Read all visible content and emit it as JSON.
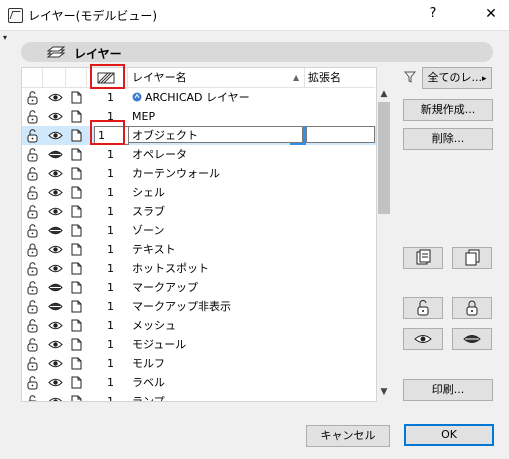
{
  "window": {
    "title": "レイヤー(モデルビュー)",
    "help_label": "?",
    "close_label": "✕"
  },
  "header": {
    "title": "レイヤー",
    "collapse_glyph": "▾"
  },
  "columns": {
    "name": "レイヤー名",
    "extension": "拡張名",
    "sort_glyph": "▲"
  },
  "rows": [
    {
      "lock": "unlocked",
      "visible": "shown",
      "wire": "solid",
      "num": "1",
      "name": "ARCHICAD レイヤー",
      "special": true
    },
    {
      "lock": "unlocked",
      "visible": "shown",
      "wire": "solid",
      "num": "1",
      "name": "MEP"
    },
    {
      "lock": "unlocked",
      "visible": "shown",
      "wire": "solid",
      "num": "1",
      "name": "オブジェクト",
      "selected": true
    },
    {
      "lock": "unlocked",
      "visible": "hidden",
      "wire": "solid",
      "num": "1",
      "name": "オペレータ"
    },
    {
      "lock": "unlocked",
      "visible": "shown",
      "wire": "solid",
      "num": "1",
      "name": "カーテンウォール"
    },
    {
      "lock": "unlocked",
      "visible": "shown",
      "wire": "solid",
      "num": "1",
      "name": "シェル"
    },
    {
      "lock": "unlocked",
      "visible": "shown",
      "wire": "solid",
      "num": "1",
      "name": "スラブ"
    },
    {
      "lock": "unlocked",
      "visible": "hidden",
      "wire": "solid",
      "num": "1",
      "name": "ゾーン"
    },
    {
      "lock": "locked",
      "visible": "shown",
      "wire": "solid",
      "num": "1",
      "name": "テキスト"
    },
    {
      "lock": "unlocked",
      "visible": "shown",
      "wire": "solid",
      "num": "1",
      "name": "ホットスポット"
    },
    {
      "lock": "unlocked",
      "visible": "hidden",
      "wire": "solid",
      "num": "1",
      "name": "マークアップ"
    },
    {
      "lock": "unlocked",
      "visible": "hidden",
      "wire": "solid",
      "num": "1",
      "name": "マークアップ非表示"
    },
    {
      "lock": "unlocked",
      "visible": "shown",
      "wire": "solid",
      "num": "1",
      "name": "メッシュ"
    },
    {
      "lock": "unlocked",
      "visible": "shown",
      "wire": "solid",
      "num": "1",
      "name": "モジュール"
    },
    {
      "lock": "unlocked",
      "visible": "shown",
      "wire": "solid",
      "num": "1",
      "name": "モルフ"
    },
    {
      "lock": "unlocked",
      "visible": "shown",
      "wire": "solid",
      "num": "1",
      "name": "ラベル"
    },
    {
      "lock": "unlocked",
      "visible": "shown",
      "wire": "solid",
      "num": "1",
      "name": "ランプ"
    }
  ],
  "scrollbar": {
    "up": "▲",
    "down": "▼"
  },
  "filter": {
    "label": "全てのレ...",
    "arrow": "▸"
  },
  "buttons": {
    "new": "新規作成...",
    "delete": "削除...",
    "print": "印刷...",
    "cancel": "キャンセル",
    "ok": "OK"
  },
  "colors": {
    "selection": "#cfe8fc",
    "accent": "#3390e4",
    "highlight": "#e0191b"
  }
}
